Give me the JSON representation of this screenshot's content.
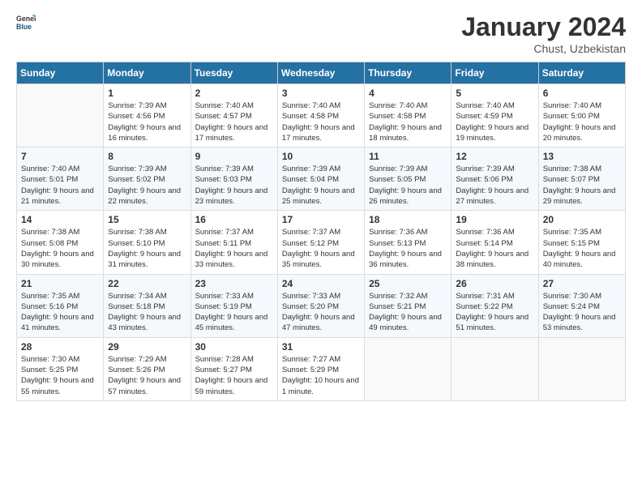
{
  "app": {
    "logo_general": "General",
    "logo_blue": "Blue"
  },
  "header": {
    "month_year": "January 2024",
    "location": "Chust, Uzbekistan"
  },
  "weekdays": [
    "Sunday",
    "Monday",
    "Tuesday",
    "Wednesday",
    "Thursday",
    "Friday",
    "Saturday"
  ],
  "weeks": [
    [
      {
        "day": "",
        "empty": true
      },
      {
        "day": "1",
        "sunrise": "Sunrise: 7:39 AM",
        "sunset": "Sunset: 4:56 PM",
        "daylight": "Daylight: 9 hours and 16 minutes."
      },
      {
        "day": "2",
        "sunrise": "Sunrise: 7:40 AM",
        "sunset": "Sunset: 4:57 PM",
        "daylight": "Daylight: 9 hours and 17 minutes."
      },
      {
        "day": "3",
        "sunrise": "Sunrise: 7:40 AM",
        "sunset": "Sunset: 4:58 PM",
        "daylight": "Daylight: 9 hours and 17 minutes."
      },
      {
        "day": "4",
        "sunrise": "Sunrise: 7:40 AM",
        "sunset": "Sunset: 4:58 PM",
        "daylight": "Daylight: 9 hours and 18 minutes."
      },
      {
        "day": "5",
        "sunrise": "Sunrise: 7:40 AM",
        "sunset": "Sunset: 4:59 PM",
        "daylight": "Daylight: 9 hours and 19 minutes."
      },
      {
        "day": "6",
        "sunrise": "Sunrise: 7:40 AM",
        "sunset": "Sunset: 5:00 PM",
        "daylight": "Daylight: 9 hours and 20 minutes."
      }
    ],
    [
      {
        "day": "7",
        "sunrise": "Sunrise: 7:40 AM",
        "sunset": "Sunset: 5:01 PM",
        "daylight": "Daylight: 9 hours and 21 minutes."
      },
      {
        "day": "8",
        "sunrise": "Sunrise: 7:39 AM",
        "sunset": "Sunset: 5:02 PM",
        "daylight": "Daylight: 9 hours and 22 minutes."
      },
      {
        "day": "9",
        "sunrise": "Sunrise: 7:39 AM",
        "sunset": "Sunset: 5:03 PM",
        "daylight": "Daylight: 9 hours and 23 minutes."
      },
      {
        "day": "10",
        "sunrise": "Sunrise: 7:39 AM",
        "sunset": "Sunset: 5:04 PM",
        "daylight": "Daylight: 9 hours and 25 minutes."
      },
      {
        "day": "11",
        "sunrise": "Sunrise: 7:39 AM",
        "sunset": "Sunset: 5:05 PM",
        "daylight": "Daylight: 9 hours and 26 minutes."
      },
      {
        "day": "12",
        "sunrise": "Sunrise: 7:39 AM",
        "sunset": "Sunset: 5:06 PM",
        "daylight": "Daylight: 9 hours and 27 minutes."
      },
      {
        "day": "13",
        "sunrise": "Sunrise: 7:38 AM",
        "sunset": "Sunset: 5:07 PM",
        "daylight": "Daylight: 9 hours and 29 minutes."
      }
    ],
    [
      {
        "day": "14",
        "sunrise": "Sunrise: 7:38 AM",
        "sunset": "Sunset: 5:08 PM",
        "daylight": "Daylight: 9 hours and 30 minutes."
      },
      {
        "day": "15",
        "sunrise": "Sunrise: 7:38 AM",
        "sunset": "Sunset: 5:10 PM",
        "daylight": "Daylight: 9 hours and 31 minutes."
      },
      {
        "day": "16",
        "sunrise": "Sunrise: 7:37 AM",
        "sunset": "Sunset: 5:11 PM",
        "daylight": "Daylight: 9 hours and 33 minutes."
      },
      {
        "day": "17",
        "sunrise": "Sunrise: 7:37 AM",
        "sunset": "Sunset: 5:12 PM",
        "daylight": "Daylight: 9 hours and 35 minutes."
      },
      {
        "day": "18",
        "sunrise": "Sunrise: 7:36 AM",
        "sunset": "Sunset: 5:13 PM",
        "daylight": "Daylight: 9 hours and 36 minutes."
      },
      {
        "day": "19",
        "sunrise": "Sunrise: 7:36 AM",
        "sunset": "Sunset: 5:14 PM",
        "daylight": "Daylight: 9 hours and 38 minutes."
      },
      {
        "day": "20",
        "sunrise": "Sunrise: 7:35 AM",
        "sunset": "Sunset: 5:15 PM",
        "daylight": "Daylight: 9 hours and 40 minutes."
      }
    ],
    [
      {
        "day": "21",
        "sunrise": "Sunrise: 7:35 AM",
        "sunset": "Sunset: 5:16 PM",
        "daylight": "Daylight: 9 hours and 41 minutes."
      },
      {
        "day": "22",
        "sunrise": "Sunrise: 7:34 AM",
        "sunset": "Sunset: 5:18 PM",
        "daylight": "Daylight: 9 hours and 43 minutes."
      },
      {
        "day": "23",
        "sunrise": "Sunrise: 7:33 AM",
        "sunset": "Sunset: 5:19 PM",
        "daylight": "Daylight: 9 hours and 45 minutes."
      },
      {
        "day": "24",
        "sunrise": "Sunrise: 7:33 AM",
        "sunset": "Sunset: 5:20 PM",
        "daylight": "Daylight: 9 hours and 47 minutes."
      },
      {
        "day": "25",
        "sunrise": "Sunrise: 7:32 AM",
        "sunset": "Sunset: 5:21 PM",
        "daylight": "Daylight: 9 hours and 49 minutes."
      },
      {
        "day": "26",
        "sunrise": "Sunrise: 7:31 AM",
        "sunset": "Sunset: 5:22 PM",
        "daylight": "Daylight: 9 hours and 51 minutes."
      },
      {
        "day": "27",
        "sunrise": "Sunrise: 7:30 AM",
        "sunset": "Sunset: 5:24 PM",
        "daylight": "Daylight: 9 hours and 53 minutes."
      }
    ],
    [
      {
        "day": "28",
        "sunrise": "Sunrise: 7:30 AM",
        "sunset": "Sunset: 5:25 PM",
        "daylight": "Daylight: 9 hours and 55 minutes."
      },
      {
        "day": "29",
        "sunrise": "Sunrise: 7:29 AM",
        "sunset": "Sunset: 5:26 PM",
        "daylight": "Daylight: 9 hours and 57 minutes."
      },
      {
        "day": "30",
        "sunrise": "Sunrise: 7:28 AM",
        "sunset": "Sunset: 5:27 PM",
        "daylight": "Daylight: 9 hours and 59 minutes."
      },
      {
        "day": "31",
        "sunrise": "Sunrise: 7:27 AM",
        "sunset": "Sunset: 5:29 PM",
        "daylight": "Daylight: 10 hours and 1 minute."
      },
      {
        "day": "",
        "empty": true
      },
      {
        "day": "",
        "empty": true
      },
      {
        "day": "",
        "empty": true
      }
    ]
  ]
}
